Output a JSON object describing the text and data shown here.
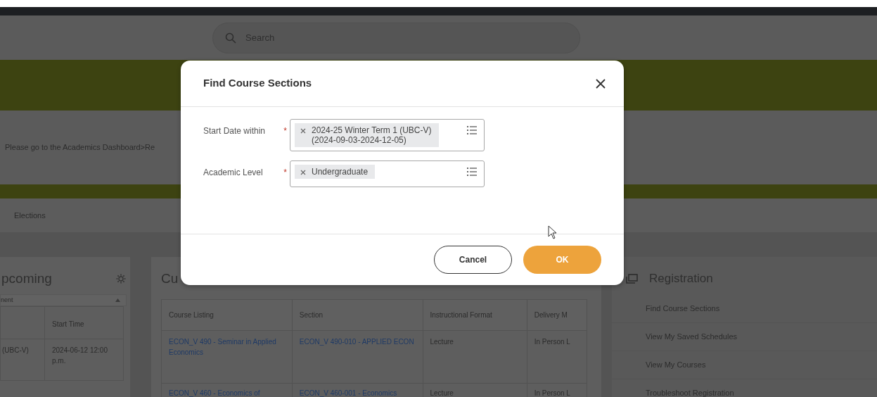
{
  "header": {
    "search": {
      "placeholder": "Search"
    }
  },
  "notice": {
    "text": "Please go to the Academics Dashboard>Re"
  },
  "nav": {
    "items": [
      "Elections"
    ]
  },
  "upcoming": {
    "title": "pcoming",
    "filter": "nent",
    "columns": [
      "",
      "Start Time"
    ],
    "rows": [
      {
        "cells": [
          "(UBC-V)",
          "2024-06-12 12:00 p.m."
        ]
      }
    ]
  },
  "current_courses": {
    "title": "Cu",
    "columns": [
      "Course Listing",
      "Section",
      "Instructional Format",
      "Delivery M"
    ],
    "rows": [
      {
        "cells": [
          {
            "kind": "link",
            "text": "ECON_V 490 - Seminar in Applied Economics"
          },
          {
            "kind": "link",
            "text": "ECON_V 490-010 - APPLIED ECON"
          },
          {
            "kind": "text",
            "text": "Lecture"
          },
          {
            "kind": "text",
            "text": "In Person L"
          }
        ]
      },
      {
        "cells": [
          {
            "kind": "link",
            "text": "ECON_V 460 - Economics of"
          },
          {
            "kind": "link",
            "text": "ECON_V 460-001 - Economics"
          },
          {
            "kind": "text",
            "text": "Lecture"
          },
          {
            "kind": "text",
            "text": "In Person L"
          }
        ]
      }
    ]
  },
  "registration": {
    "title": "Registration",
    "items": [
      "Find Course Sections",
      "View My Saved Schedules",
      "View My Courses",
      "Troubleshoot Registration"
    ]
  },
  "dialog": {
    "title": "Find Course Sections",
    "fields": [
      {
        "label": "Start Date within",
        "required_mark": "*",
        "chips": [
          {
            "lines": [
              "2024-25 Winter Term 1 (UBC-V)",
              "(2024-09-03-2024-12-05)"
            ]
          }
        ]
      },
      {
        "label": "Academic Level",
        "required_mark": "*",
        "chips": [
          {
            "lines": [
              "Undergraduate"
            ]
          }
        ]
      }
    ],
    "buttons": [
      {
        "label": "Cancel",
        "kind": "secondary"
      },
      {
        "label": "OK",
        "kind": "primary"
      }
    ]
  }
}
